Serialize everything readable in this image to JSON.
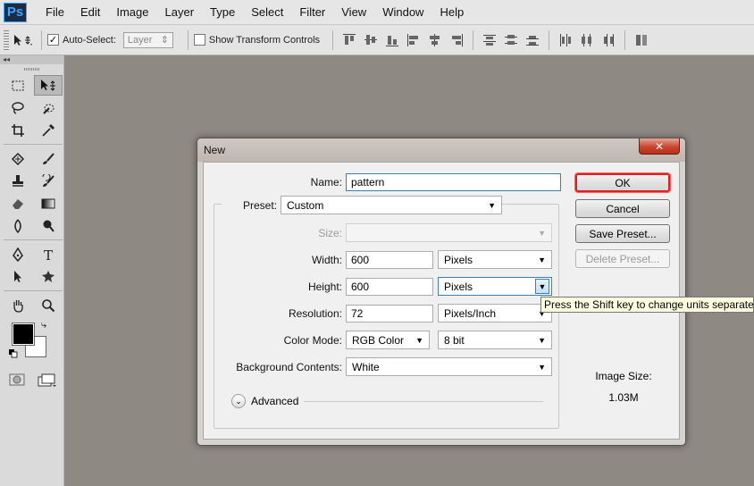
{
  "app": {
    "logo": "Ps"
  },
  "menu": [
    "File",
    "Edit",
    "Image",
    "Layer",
    "Type",
    "Select",
    "Filter",
    "View",
    "Window",
    "Help"
  ],
  "options": {
    "auto_select_label": "Auto-Select:",
    "auto_select_checked": true,
    "auto_select_target": "Layer",
    "show_transform_label": "Show Transform Controls",
    "show_transform_checked": false
  },
  "toolbox": {
    "collapse_glyph": "◂◂"
  },
  "dialog": {
    "title": "New",
    "close_glyph": "✕",
    "name_label": "Name:",
    "name_value": "pattern",
    "preset_label": "Preset:",
    "preset_value": "Custom",
    "size_label": "Size:",
    "size_value": "",
    "width_label": "Width:",
    "width_value": "600",
    "width_unit": "Pixels",
    "height_label": "Height:",
    "height_value": "600",
    "height_unit": "Pixels",
    "resolution_label": "Resolution:",
    "resolution_value": "72",
    "resolution_unit": "Pixels/Inch",
    "color_mode_label": "Color Mode:",
    "color_mode_value": "RGB Color",
    "bit_depth_value": "8 bit",
    "background_label": "Background Contents:",
    "background_value": "White",
    "advanced_label": "Advanced",
    "ok_label": "OK",
    "cancel_label": "Cancel",
    "save_preset_label": "Save Preset...",
    "delete_preset_label": "Delete Preset...",
    "image_size_label": "Image Size:",
    "image_size_value": "1.03M"
  },
  "tooltip": {
    "text": "Press the Shift key to change units separately"
  },
  "colors": {
    "canvas_bg": "#8f8984",
    "ok_highlight": "#e02020",
    "close_button": "#c9452e",
    "tooltip_bg": "#ffffe1"
  }
}
